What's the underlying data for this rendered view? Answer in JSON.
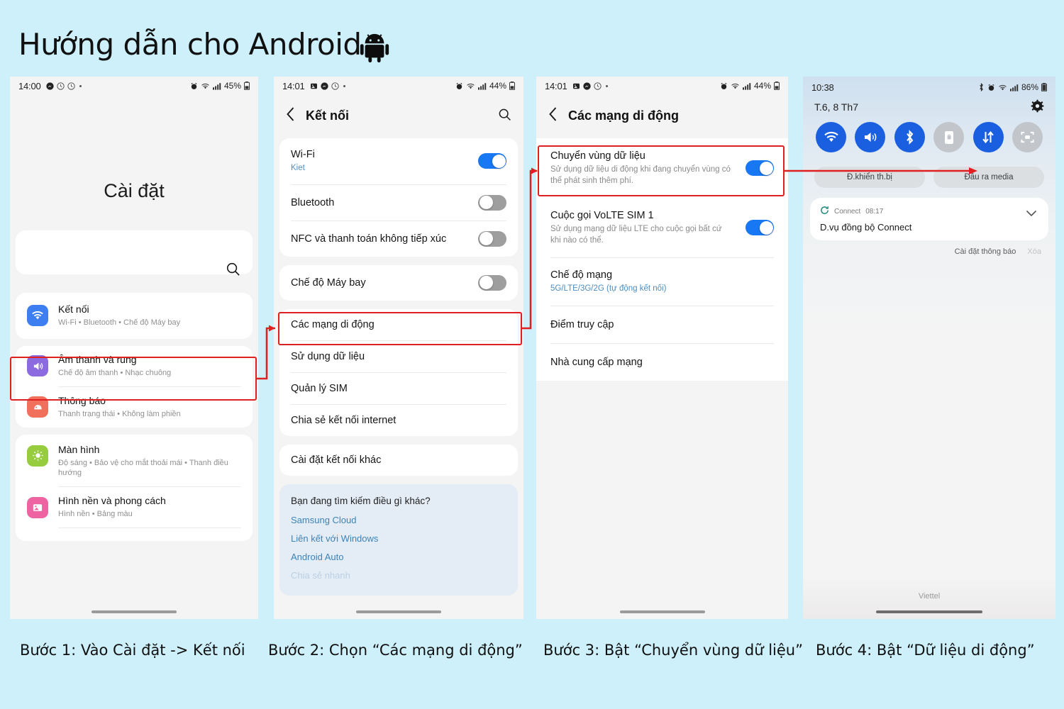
{
  "header": {
    "title": "Hướng dẫn cho Android",
    "logo_icon": "android-robot-icon"
  },
  "phone1": {
    "status": {
      "time": "14:00",
      "battery": "45%"
    },
    "title": "Cài đặt",
    "items": [
      {
        "title": "Kết nối",
        "sub": "Wi-Fi • Bluetooth • Chế độ Máy bay",
        "icon": "wifi-icon",
        "color": "#3d7ef0"
      },
      {
        "title": "Âm thanh và rung",
        "sub": "Chế độ âm thanh • Nhạc chuông",
        "icon": "speaker-icon",
        "color": "#8c6ae0"
      },
      {
        "title": "Thông báo",
        "sub": "Thanh trạng thái • Không làm phiền",
        "icon": "bell-icon",
        "color": "#f0705c"
      },
      {
        "title": "Màn hình",
        "sub": "Độ sáng • Bảo vệ cho mắt thoải mái • Thanh điều hướng",
        "icon": "brightness-icon",
        "color": "#97cc3f"
      },
      {
        "title": "Hình nền và phong cách",
        "sub": "Hình nền • Bảng màu",
        "icon": "image-icon",
        "color": "#ee63a2"
      }
    ]
  },
  "phone2": {
    "status": {
      "time": "14:01",
      "battery": "44%"
    },
    "header": {
      "back_icon": "chevron-left-icon",
      "title": "Kết nối",
      "search_icon": "search-icon"
    },
    "group1": [
      {
        "title": "Wi-Fi",
        "sub": "Kiet",
        "toggle": "on"
      },
      {
        "title": "Bluetooth",
        "sub": "",
        "toggle": "off"
      },
      {
        "title": "NFC và thanh toán không tiếp xúc",
        "sub": "",
        "toggle": "off"
      }
    ],
    "group2": [
      {
        "title": "Chế độ Máy bay",
        "sub": "",
        "toggle": "off"
      }
    ],
    "group3": [
      {
        "title": "Các mạng di động"
      },
      {
        "title": "Sử dụng dữ liệu"
      },
      {
        "title": "Quản lý SIM"
      },
      {
        "title": "Chia sẻ kết nối internet"
      }
    ],
    "group4": [
      {
        "title": "Cài đặt kết nối khác"
      }
    ],
    "suggest": {
      "question": "Bạn đang tìm kiếm điều gì khác?",
      "links": [
        "Samsung Cloud",
        "Liên kết với Windows",
        "Android Auto"
      ]
    }
  },
  "phone3": {
    "status": {
      "time": "14:01",
      "battery": "44%"
    },
    "header": {
      "back_icon": "chevron-left-icon",
      "title": "Các mạng di động"
    },
    "items": [
      {
        "title": "Chuyển vùng dữ liệu",
        "sub": "Sử dụng dữ liệu di động khi đang chuyển vùng có thể phát sinh thêm phí.",
        "toggle": "on",
        "sub_blue": false
      },
      {
        "title": "Cuộc gọi VoLTE SIM 1",
        "sub": "Sử dụng mạng dữ liệu LTE cho cuộc gọi bất cứ khi nào có thể.",
        "toggle": "on",
        "sub_blue": false
      },
      {
        "title": "Chế độ mạng",
        "sub": "5G/LTE/3G/2G (tự động kết nối)",
        "toggle": "none",
        "sub_blue": true
      },
      {
        "title": "Điểm truy cập",
        "sub": "",
        "toggle": "none",
        "sub_blue": false
      },
      {
        "title": "Nhà cung cấp mạng",
        "sub": "",
        "toggle": "none",
        "sub_blue": false
      }
    ]
  },
  "phone4": {
    "status": {
      "time": "10:38",
      "battery": "86%"
    },
    "date": "T.6, 8 Th7",
    "settings_icon": "gear-icon",
    "tiles": [
      {
        "name": "wifi-tile",
        "icon": "wifi-icon",
        "state": "on"
      },
      {
        "name": "sound-tile",
        "icon": "speaker-icon",
        "state": "on"
      },
      {
        "name": "bluetooth-tile",
        "icon": "bluetooth-icon",
        "state": "on"
      },
      {
        "name": "autorotate-tile",
        "icon": "rotate-lock-icon",
        "state": "off"
      },
      {
        "name": "mobiledata-tile",
        "icon": "data-arrows-icon",
        "state": "on"
      },
      {
        "name": "smartview-tile",
        "icon": "smart-view-icon",
        "state": "off"
      }
    ],
    "pills": [
      "Đ.khiển th.bị",
      "Đầu ra media"
    ],
    "notification": {
      "app": "Connect",
      "time": "08:17",
      "body": "D.vụ đồng bộ Connect",
      "sync_icon": "sync-icon",
      "expand_icon": "chevron-down-icon"
    },
    "actions": [
      "Cài đặt thông báo",
      "Xóa"
    ],
    "carrier": "Viettel"
  },
  "captions": [
    "Bước 1: Vào Cài đặt -> Kết nối",
    "Bước 2: Chọn “Các mạng di động”",
    "Bước 3: Bật “Chuyển vùng dữ liệu”",
    "Bước 4: Bật “Dữ liệu di động”"
  ],
  "colors": {
    "background": "#cdf0fb",
    "highlight": "#e02020",
    "accent": "#1877f2",
    "tile_on": "#1a5fe0"
  }
}
